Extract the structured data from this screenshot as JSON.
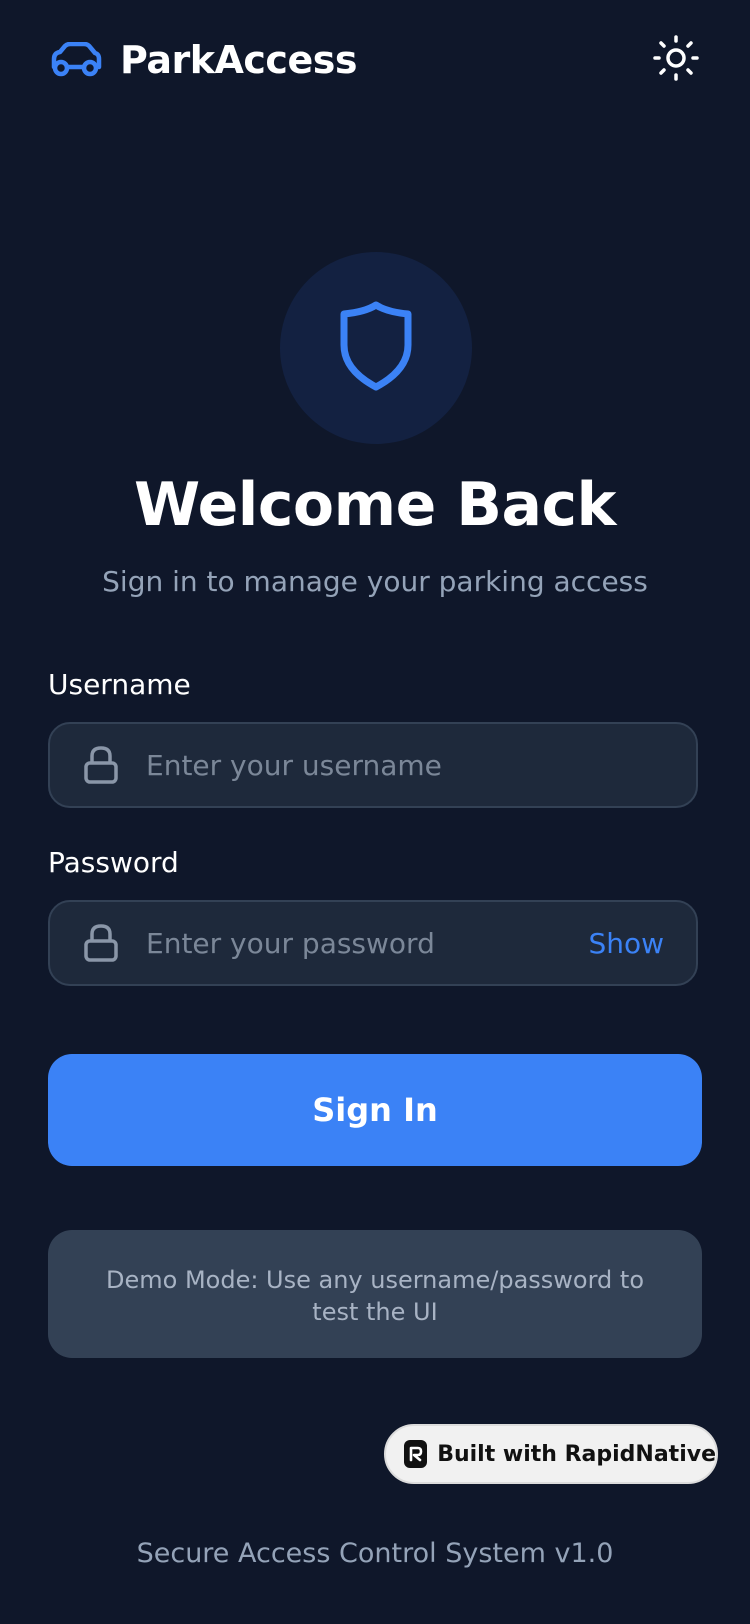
{
  "header": {
    "app_name": "ParkAccess",
    "brand_icon": "car-icon",
    "theme_toggle_icon": "sun-icon"
  },
  "hero": {
    "icon": "shield-icon",
    "title": "Welcome Back",
    "subtitle": "Sign in to manage your parking access"
  },
  "form": {
    "username": {
      "label": "Username",
      "placeholder": "Enter your username",
      "value": "",
      "icon": "lock-icon"
    },
    "password": {
      "label": "Password",
      "placeholder": "Enter your password",
      "value": "",
      "icon": "lock-icon",
      "toggle_label": "Show"
    },
    "submit_label": "Sign In"
  },
  "demo_note": "Demo Mode: Use any username/password to test the UI",
  "badge": {
    "label": "Built with RapidNative",
    "icon": "rapidnative-logo-icon"
  },
  "footer": "Secure Access Control System v1.0",
  "colors": {
    "background": "#0f172a",
    "accent": "#3b82f6",
    "input_bg": "#1e293b",
    "muted_text": "#94a3b8"
  }
}
